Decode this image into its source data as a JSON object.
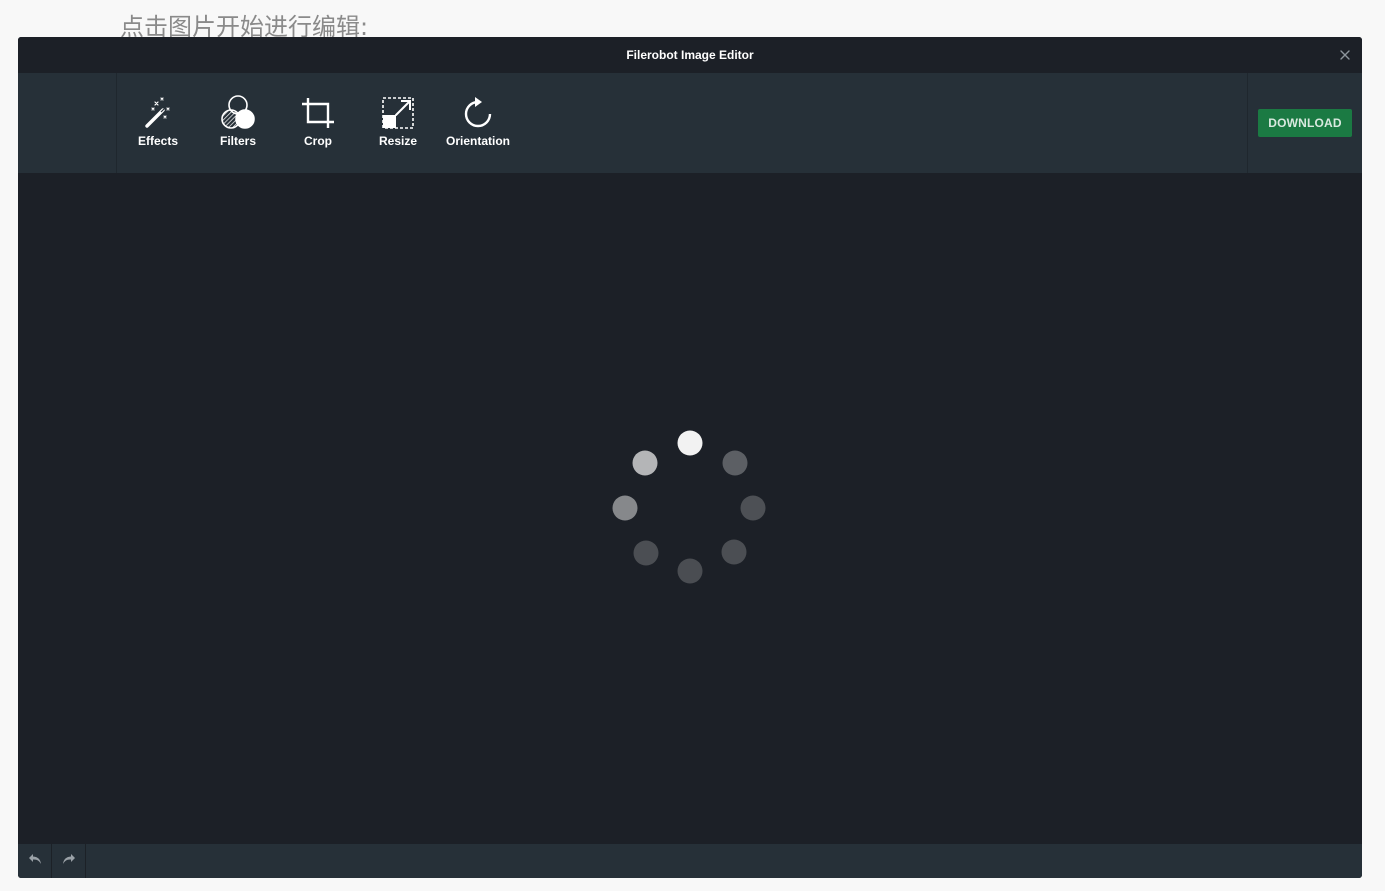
{
  "page": {
    "heading": "点击图片开始进行编辑:"
  },
  "editor": {
    "title": "Filerobot Image Editor",
    "close_icon": "close-icon",
    "tools": [
      {
        "id": "effects",
        "label": "Effects",
        "icon": "magic-wand-icon"
      },
      {
        "id": "filters",
        "label": "Filters",
        "icon": "filters-circles-icon"
      },
      {
        "id": "crop",
        "label": "Crop",
        "icon": "crop-icon"
      },
      {
        "id": "resize",
        "label": "Resize",
        "icon": "resize-icon"
      },
      {
        "id": "orientation",
        "label": "Orientation",
        "icon": "rotate-icon"
      }
    ],
    "download_label": "DOWNLOAD",
    "footer": {
      "undo_icon": "undo-icon",
      "redo_icon": "redo-icon"
    },
    "loading": {
      "indicator": "loading-spinner",
      "dots": 8
    }
  },
  "colors": {
    "editor_bg": "#1c2027",
    "toolbar_bg": "#263038",
    "download_bg": "#1b7a43",
    "heading_text": "#8a8a8a"
  }
}
